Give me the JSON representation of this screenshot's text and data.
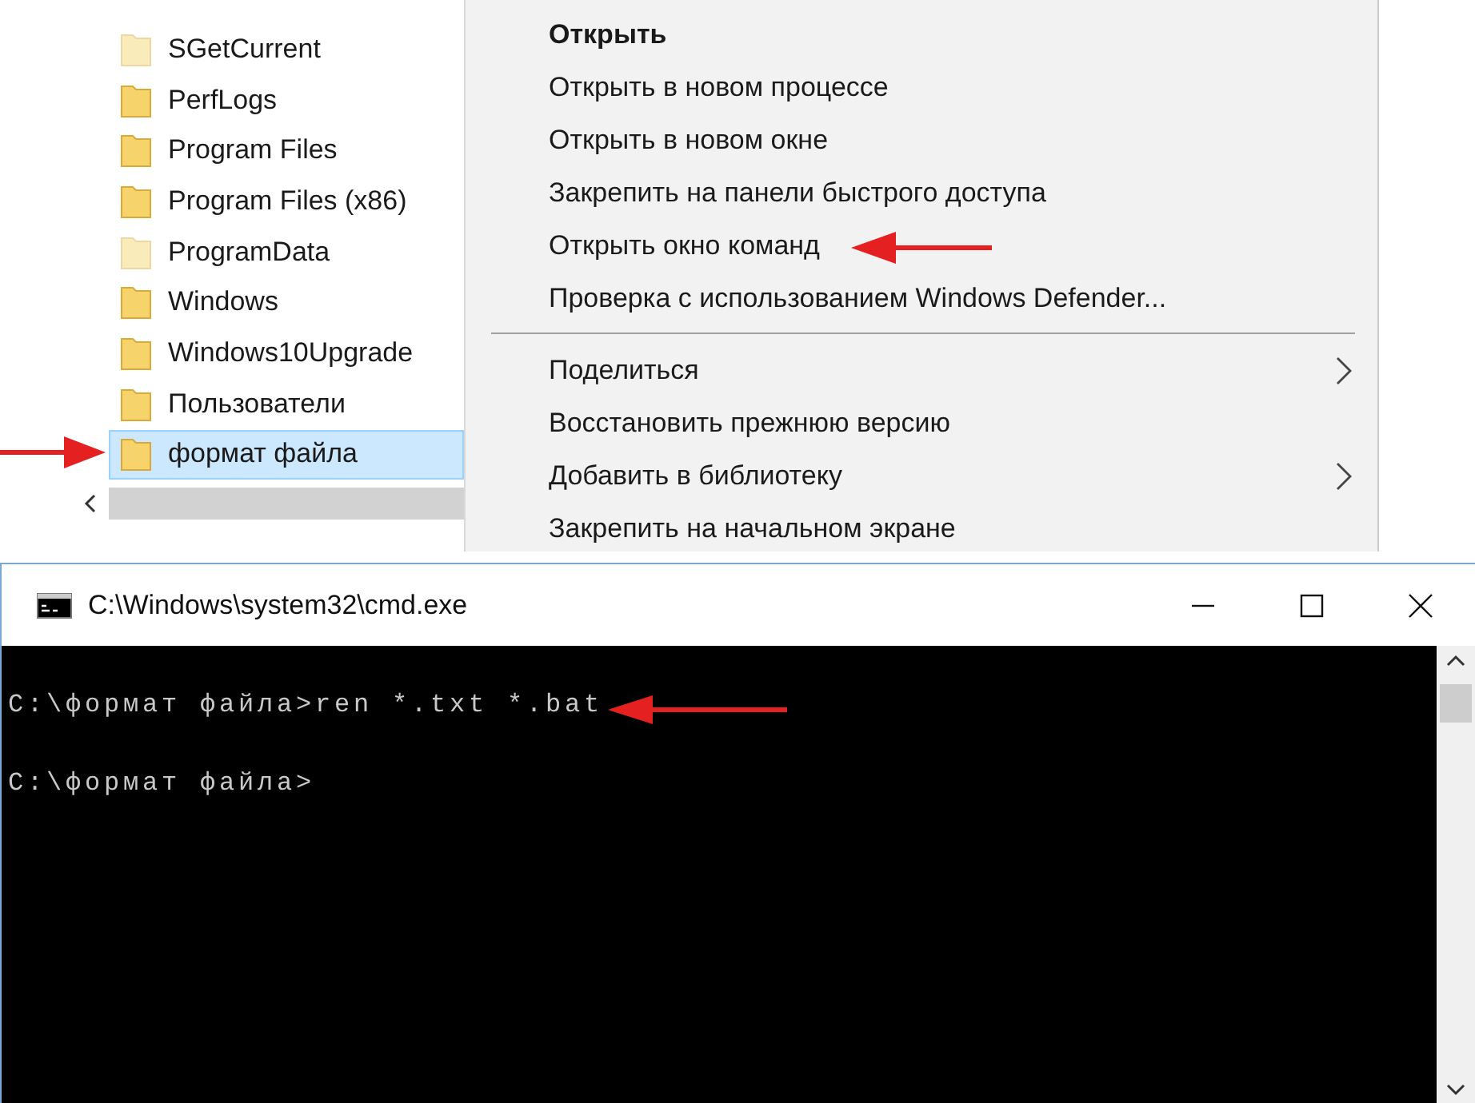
{
  "explorer": {
    "items": [
      {
        "name": "SGetCurrent",
        "hidden": true,
        "selected": false
      },
      {
        "name": "PerfLogs",
        "hidden": false,
        "selected": false
      },
      {
        "name": "Program Files",
        "hidden": false,
        "selected": false
      },
      {
        "name": "Program Files (x86)",
        "hidden": false,
        "selected": false
      },
      {
        "name": "ProgramData",
        "hidden": true,
        "selected": false
      },
      {
        "name": "Windows",
        "hidden": false,
        "selected": false
      },
      {
        "name": "Windows10Upgrade",
        "hidden": false,
        "selected": false
      },
      {
        "name": "Пользователи",
        "hidden": false,
        "selected": false
      },
      {
        "name": "формат файла",
        "hidden": false,
        "selected": true
      }
    ]
  },
  "context_menu": {
    "items": [
      {
        "kind": "item",
        "label": "Открыть",
        "default": true,
        "submenu": false
      },
      {
        "kind": "item",
        "label": "Открыть в новом процессе",
        "default": false,
        "submenu": false
      },
      {
        "kind": "item",
        "label": "Открыть в новом окне",
        "default": false,
        "submenu": false
      },
      {
        "kind": "item",
        "label": "Закрепить на панели быстрого доступа",
        "default": false,
        "submenu": false
      },
      {
        "kind": "item",
        "label": "Открыть окно команд",
        "default": false,
        "submenu": false
      },
      {
        "kind": "item",
        "label": "Проверка с использованием Windows Defender...",
        "default": false,
        "submenu": false
      },
      {
        "kind": "separator"
      },
      {
        "kind": "item",
        "label": "Поделиться",
        "default": false,
        "submenu": true
      },
      {
        "kind": "item",
        "label": "Восстановить прежнюю версию",
        "default": false,
        "submenu": false
      },
      {
        "kind": "item",
        "label": "Добавить в библиотеку",
        "default": false,
        "submenu": true
      },
      {
        "kind": "item",
        "label": "Закрепить на начальном экране",
        "default": false,
        "submenu": false
      }
    ]
  },
  "cmd_window": {
    "title": "C:\\Windows\\system32\\cmd.exe",
    "lines": [
      "C:\\формат файла>ren *.txt *.bat",
      "C:\\формат файла>"
    ]
  }
}
